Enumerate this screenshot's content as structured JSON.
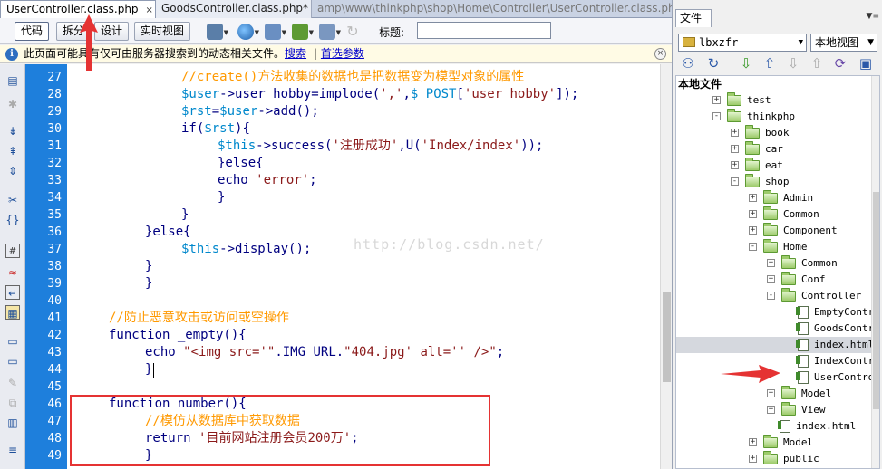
{
  "tabs": [
    {
      "label": "UserController.class.php",
      "close": "×"
    },
    {
      "label": "GoodsController.class.php*",
      "close": "×"
    }
  ],
  "path": "amp\\www\\thinkphp\\shop\\Home\\Controller\\UserController.class.php",
  "toolbar": {
    "code": "代码",
    "split": "拆分",
    "design": "设计",
    "live": "实时视图",
    "title_label": "标题:",
    "title_value": ""
  },
  "infobar": {
    "message": "此页面可能具有仅可由服务器搜索到的动态相关文件。",
    "search_link": "搜索",
    "separator": "|",
    "prefs_link": "首选参数",
    "close": "×"
  },
  "code": {
    "line_numbers": [
      "27",
      "28",
      "29",
      "30",
      "31",
      "32",
      "33",
      "34",
      "35",
      "36",
      "37",
      "38",
      "39",
      "40",
      "41",
      "42",
      "43",
      "44",
      "45",
      "46",
      "47",
      "48",
      "49"
    ],
    "watermark": "http://blog.csdn.net/"
  },
  "panel": {
    "tab": "文件",
    "site": "lbxzfr",
    "view": "本地视图",
    "root": "本地文件",
    "tree": [
      {
        "name": "test",
        "type": "folder",
        "depth": 1,
        "toggle": "+"
      },
      {
        "name": "thinkphp",
        "type": "folder",
        "depth": 1,
        "toggle": "-"
      },
      {
        "name": "book",
        "type": "folder",
        "depth": 2,
        "toggle": "+"
      },
      {
        "name": "car",
        "type": "folder",
        "depth": 2,
        "toggle": "+"
      },
      {
        "name": "eat",
        "type": "folder",
        "depth": 2,
        "toggle": "+"
      },
      {
        "name": "shop",
        "type": "folder",
        "depth": 2,
        "toggle": "-"
      },
      {
        "name": "Admin",
        "type": "folder",
        "depth": 3,
        "toggle": "+"
      },
      {
        "name": "Common",
        "type": "folder",
        "depth": 3,
        "toggle": "+"
      },
      {
        "name": "Component",
        "type": "folder",
        "depth": 3,
        "toggle": "+"
      },
      {
        "name": "Home",
        "type": "folder",
        "depth": 3,
        "toggle": "-"
      },
      {
        "name": "Common",
        "type": "folder",
        "depth": 4,
        "toggle": "+"
      },
      {
        "name": "Conf",
        "type": "folder",
        "depth": 4,
        "toggle": "+"
      },
      {
        "name": "Controller",
        "type": "folder",
        "depth": 4,
        "toggle": "-"
      },
      {
        "name": "EmptyContr",
        "type": "file",
        "depth": 5
      },
      {
        "name": "GoodsContr",
        "type": "file",
        "depth": 5
      },
      {
        "name": "index.html",
        "type": "file",
        "depth": 5,
        "highlight": true
      },
      {
        "name": "IndexContr",
        "type": "file",
        "depth": 5
      },
      {
        "name": "UserControl",
        "type": "file",
        "depth": 5
      },
      {
        "name": "Model",
        "type": "folder",
        "depth": 4,
        "toggle": "+"
      },
      {
        "name": "View",
        "type": "folder",
        "depth": 4,
        "toggle": "+"
      },
      {
        "name": "index.html",
        "type": "file",
        "depth": 4
      },
      {
        "name": "Model",
        "type": "folder",
        "depth": 3,
        "toggle": "+"
      },
      {
        "name": "public",
        "type": "folder",
        "depth": 3,
        "toggle": "+"
      }
    ]
  }
}
